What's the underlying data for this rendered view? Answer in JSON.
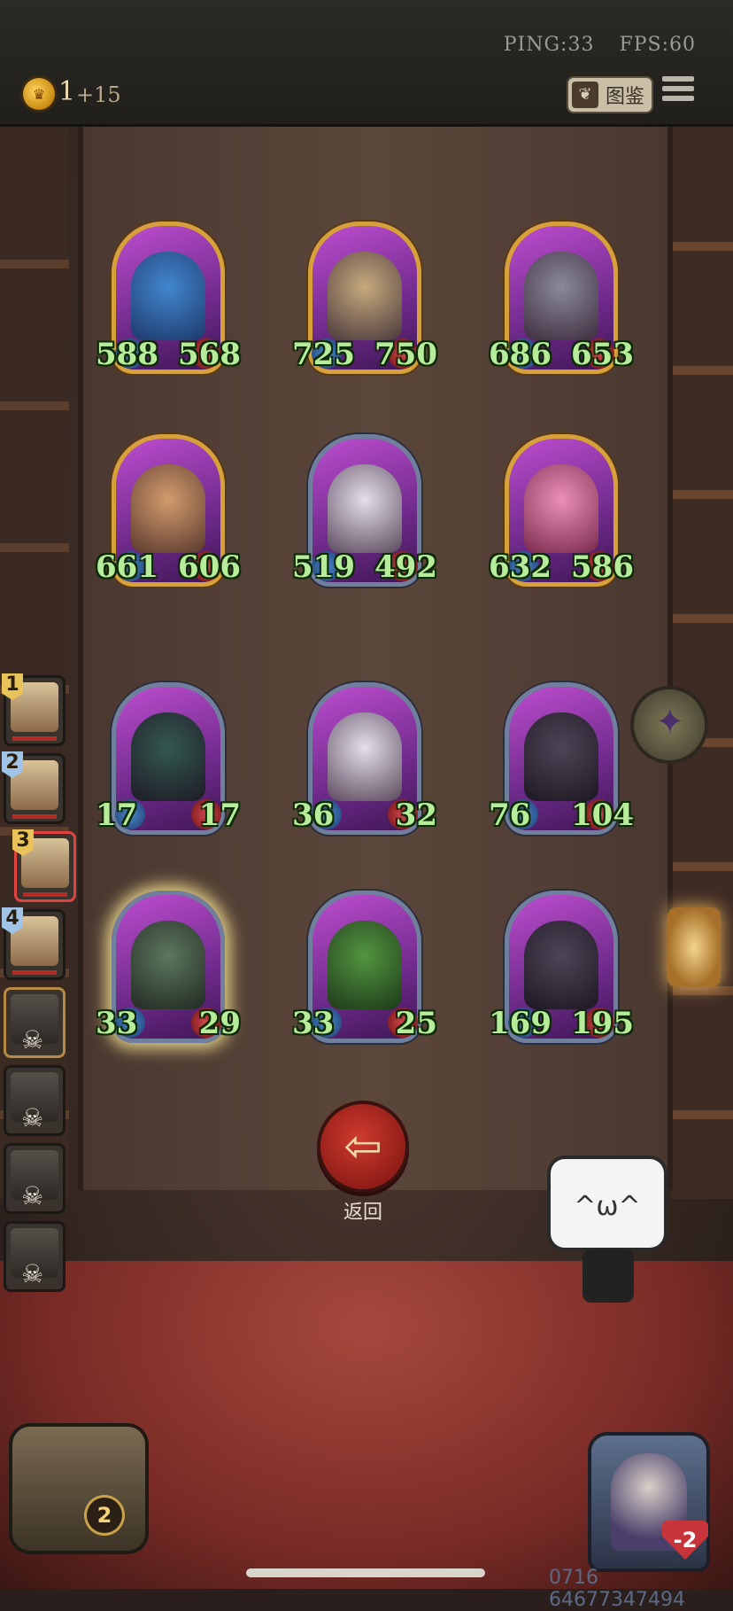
{
  "status": {
    "ping": "PING:33",
    "fps": "FPS:60"
  },
  "currency": {
    "amount": "1",
    "income": "+15",
    "icon": "crown-coin-icon"
  },
  "header": {
    "codex_label": "图鉴",
    "codex_icon": "book-icon",
    "menu_icon": "hamburger-menu-icon"
  },
  "board": {
    "cards": [
      {
        "name": "blue-elf-sorceress",
        "attack": "588",
        "health": "568",
        "frame": "gold"
      },
      {
        "name": "mushroom-spider",
        "attack": "725",
        "health": "750",
        "frame": "gold"
      },
      {
        "name": "gray-rat-bandit",
        "attack": "686",
        "health": "653",
        "frame": "gold"
      },
      {
        "name": "flower-hat-witch",
        "attack": "661",
        "health": "606",
        "frame": "gold"
      },
      {
        "name": "husky-dog",
        "attack": "519",
        "health": "492",
        "frame": "silver"
      },
      {
        "name": "pink-hair-lady",
        "attack": "632",
        "health": "586",
        "frame": "gold"
      },
      {
        "name": "horned-dark-elf",
        "attack": "17",
        "health": "17",
        "frame": "silver"
      },
      {
        "name": "husky-dog",
        "attack": "36",
        "health": "32",
        "frame": "silver"
      },
      {
        "name": "black-dragon",
        "attack": "76",
        "health": "104",
        "frame": "silver"
      },
      {
        "name": "green-ogre",
        "attack": "33",
        "health": "29",
        "frame": "silver"
      },
      {
        "name": "green-dragon",
        "attack": "33",
        "health": "25",
        "frame": "silver"
      },
      {
        "name": "black-dragon",
        "attack": "169",
        "health": "195",
        "frame": "silver"
      }
    ]
  },
  "team": {
    "slots": [
      {
        "rank": "1",
        "state": "alive"
      },
      {
        "rank": "2",
        "state": "alive"
      },
      {
        "rank": "3",
        "state": "selected"
      },
      {
        "rank": "4",
        "state": "alive"
      },
      {
        "rank": "",
        "state": "dead"
      },
      {
        "rank": "",
        "state": "dead"
      },
      {
        "rank": "",
        "state": "dead"
      },
      {
        "rank": "",
        "state": "dead"
      }
    ]
  },
  "actions": {
    "back_label": "返回",
    "back_icon": "arrow-left-icon"
  },
  "chest": {
    "count": "2"
  },
  "hero": {
    "health_delta": "-2"
  },
  "footer": {
    "stamp": "0716 64677347494"
  }
}
